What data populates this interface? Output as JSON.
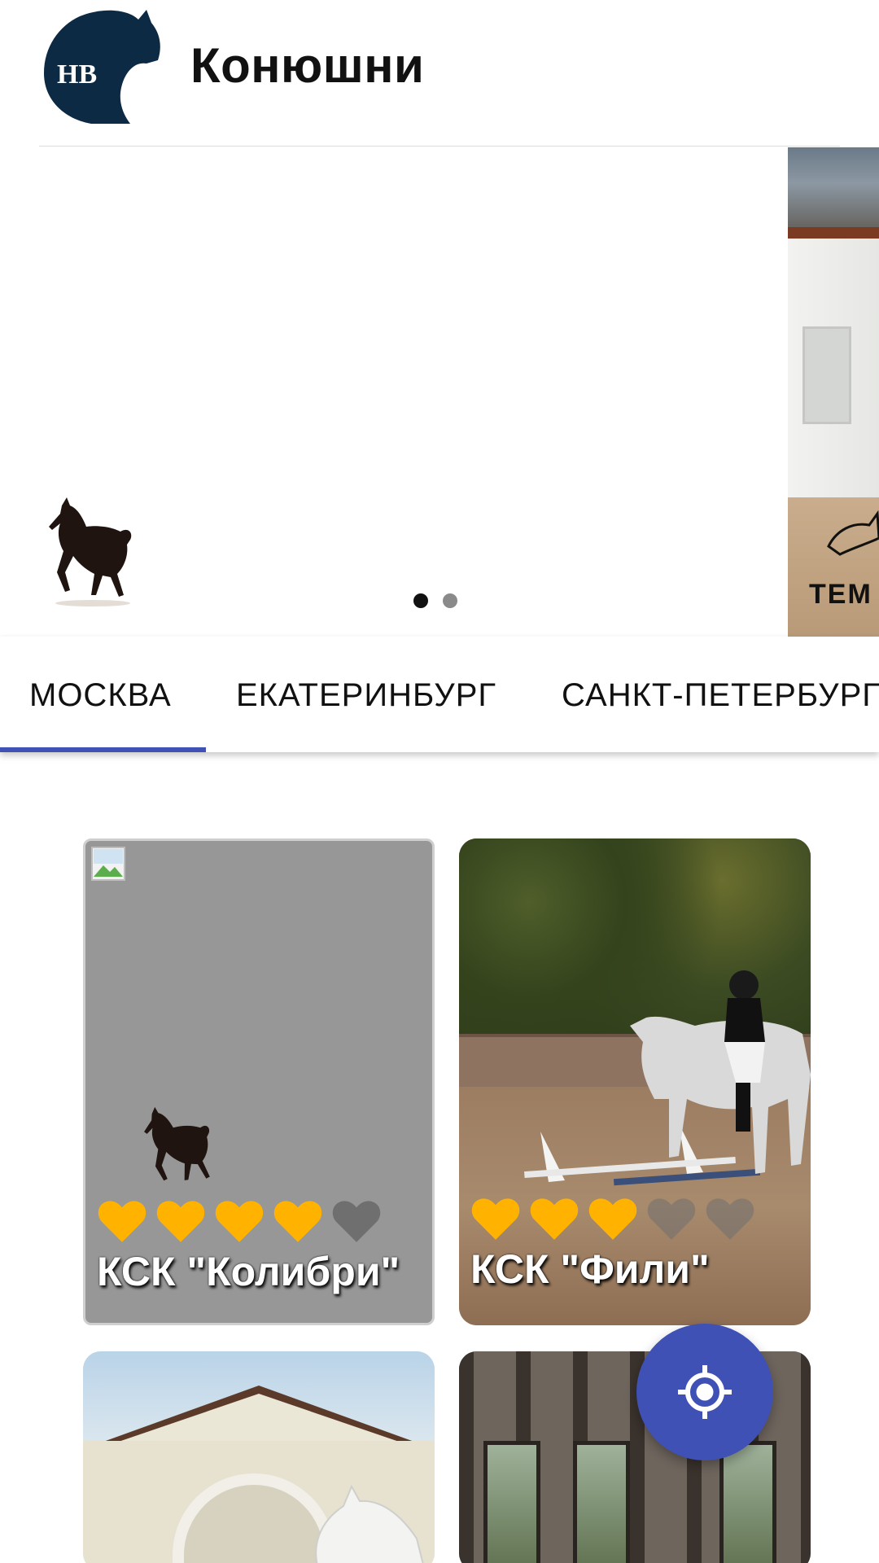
{
  "header": {
    "title": "Конюшни",
    "logo_icon": "hb-horse-logo-icon",
    "logo_text": "НВ"
  },
  "carousel": {
    "slide_count": 2,
    "active_index": 0,
    "peek_brand_text": "TEM"
  },
  "tabs": {
    "items": [
      {
        "label": "МОСКВА",
        "selected": true
      },
      {
        "label": "ЕКАТЕРИНБУРГ",
        "selected": false
      },
      {
        "label": "САНКТ-ПЕТЕРБУРГ",
        "selected": false
      }
    ],
    "indicator_color": "#3f51b5"
  },
  "stables": [
    {
      "name": "КСК \"Колибри\"",
      "rating": 4,
      "max_rating": 5
    },
    {
      "name": "КСК \"Фили\"",
      "rating": 3,
      "max_rating": 5
    },
    {
      "name": "",
      "rating": null
    },
    {
      "name": "",
      "rating": null
    }
  ],
  "fab": {
    "icon": "my-location-icon",
    "color": "#3f51b5"
  },
  "colors": {
    "heart_filled": "#ffb300",
    "heart_empty": "#6f6f6f"
  }
}
